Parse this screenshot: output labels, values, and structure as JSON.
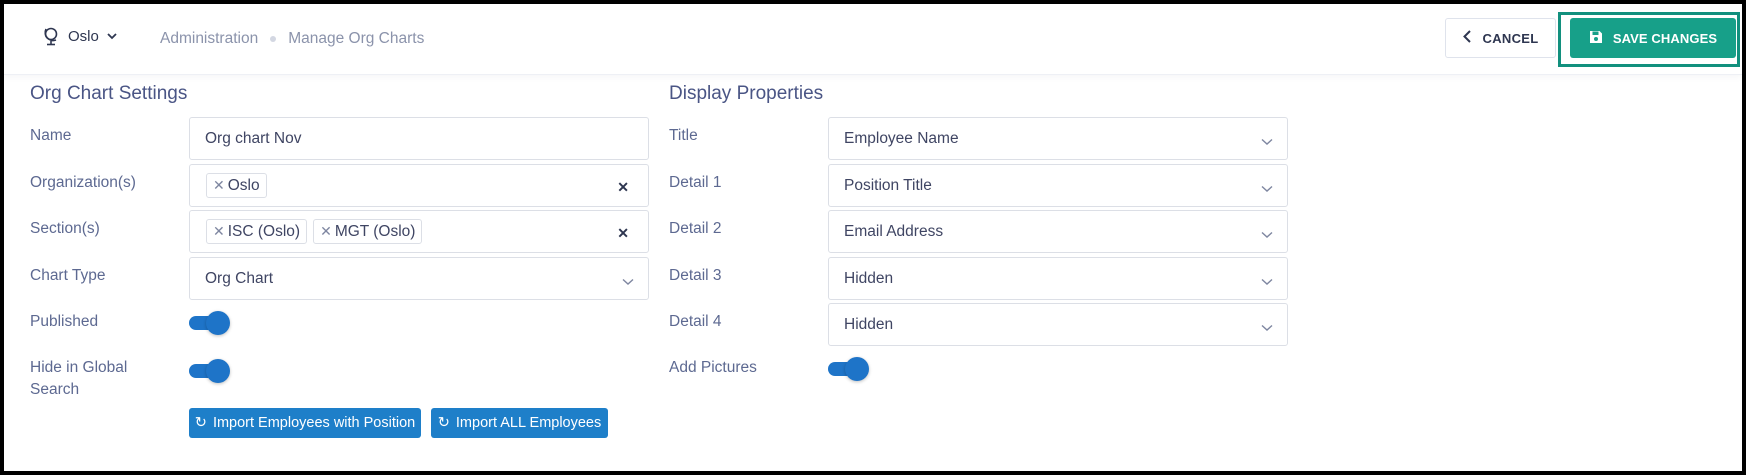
{
  "header": {
    "location": "Oslo",
    "breadcrumb": [
      "Administration",
      "Manage Org Charts"
    ],
    "cancel_label": "CANCEL",
    "save_label": "SAVE CHANGES"
  },
  "settings": {
    "title": "Org Chart Settings",
    "name_label": "Name",
    "name_value": "Org chart Nov",
    "org_label": "Organization(s)",
    "orgs": [
      "Oslo"
    ],
    "section_label": "Section(s)",
    "sections": [
      "ISC (Oslo)",
      "MGT (Oslo)"
    ],
    "chart_type_label": "Chart Type",
    "chart_type_value": "Org Chart",
    "published_label": "Published",
    "published": true,
    "hide_label": "Hide in Global Search",
    "hide_in_search": true,
    "import_position_label": "Import Employees with Position",
    "import_all_label": "Import ALL Employees"
  },
  "display": {
    "title": "Display Properties",
    "title_label": "Title",
    "title_value": "Employee Name",
    "detail1_label": "Detail 1",
    "detail1_value": "Position Title",
    "detail2_label": "Detail 2",
    "detail2_value": "Email Address",
    "detail3_label": "Detail 3",
    "detail3_value": "Hidden",
    "detail4_label": "Detail 4",
    "detail4_value": "Hidden",
    "pictures_label": "Add Pictures",
    "add_pictures": true
  },
  "colors": {
    "accent_save": "#17a089",
    "toggle_blue": "#1e74c8"
  }
}
